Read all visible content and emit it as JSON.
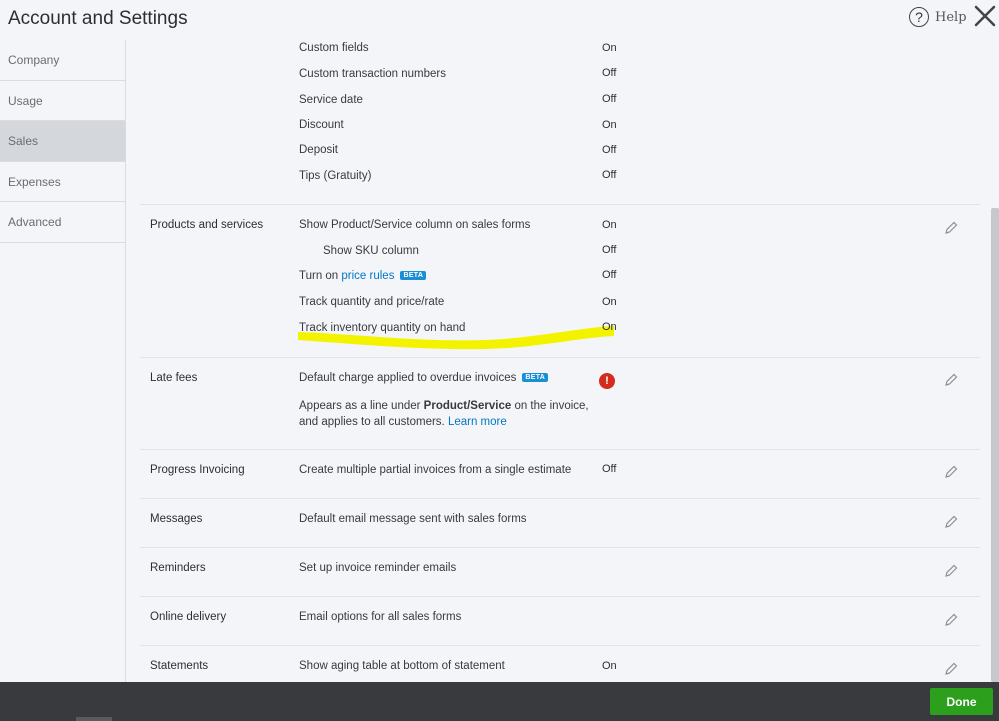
{
  "header": {
    "title": "Account and Settings",
    "help_label": "Help",
    "help_icon_glyph": "?"
  },
  "sidebar": {
    "items": [
      {
        "label": "Company"
      },
      {
        "label": "Usage"
      },
      {
        "label": "Sales",
        "active": true
      },
      {
        "label": "Expenses"
      },
      {
        "label": "Advanced"
      }
    ]
  },
  "custom_section": {
    "rows": [
      {
        "label": "Custom fields",
        "value": "On"
      },
      {
        "label": "Custom transaction numbers",
        "value": "Off"
      },
      {
        "label": "Service date",
        "value": "Off"
      },
      {
        "label": "Discount",
        "value": "On"
      },
      {
        "label": "Deposit",
        "value": "Off"
      },
      {
        "label": "Tips (Gratuity)",
        "value": "Off"
      }
    ]
  },
  "products": {
    "title": "Products and services",
    "rows": [
      {
        "label": "Show Product/Service column on sales forms",
        "value": "On"
      },
      {
        "label": "Show SKU column",
        "value": "Off"
      },
      {
        "label_prefix": "Turn on ",
        "link": "price rules",
        "badge": "BETA",
        "value": "Off"
      },
      {
        "label": "Track quantity and price/rate",
        "value": "On"
      },
      {
        "label": "Track inventory quantity on hand",
        "value": "On"
      }
    ]
  },
  "late_fees": {
    "title": "Late fees",
    "label": "Default charge applied to overdue invoices",
    "badge": "BETA",
    "alert_glyph": "!",
    "desc_1": "Appears as a line under ",
    "desc_bold": "Product/Service",
    "desc_2": " on the invoice,",
    "desc_3": "and applies to all customers. ",
    "learn_more": "Learn more"
  },
  "sections": [
    {
      "title": "Progress Invoicing",
      "label": "Create multiple partial invoices from a single estimate",
      "value": "Off"
    },
    {
      "title": "Messages",
      "label": "Default email message sent with sales forms"
    },
    {
      "title": "Reminders",
      "label": "Set up invoice reminder emails"
    },
    {
      "title": "Online delivery",
      "label": "Email options for all sales forms"
    },
    {
      "title": "Statements",
      "label": "Show aging table at bottom of statement",
      "value": "On"
    }
  ],
  "footer": {
    "done_label": "Done"
  },
  "colors": {
    "accent_link": "#0077c5",
    "done_green": "#2ca01c",
    "beta_blue": "#1a8fd6",
    "alert_red": "#d52b1e",
    "highlight": "#f3f300"
  },
  "icons": {
    "help": "help-icon",
    "close": "close-icon",
    "edit": "pencil-icon",
    "alert": "alert-icon"
  }
}
